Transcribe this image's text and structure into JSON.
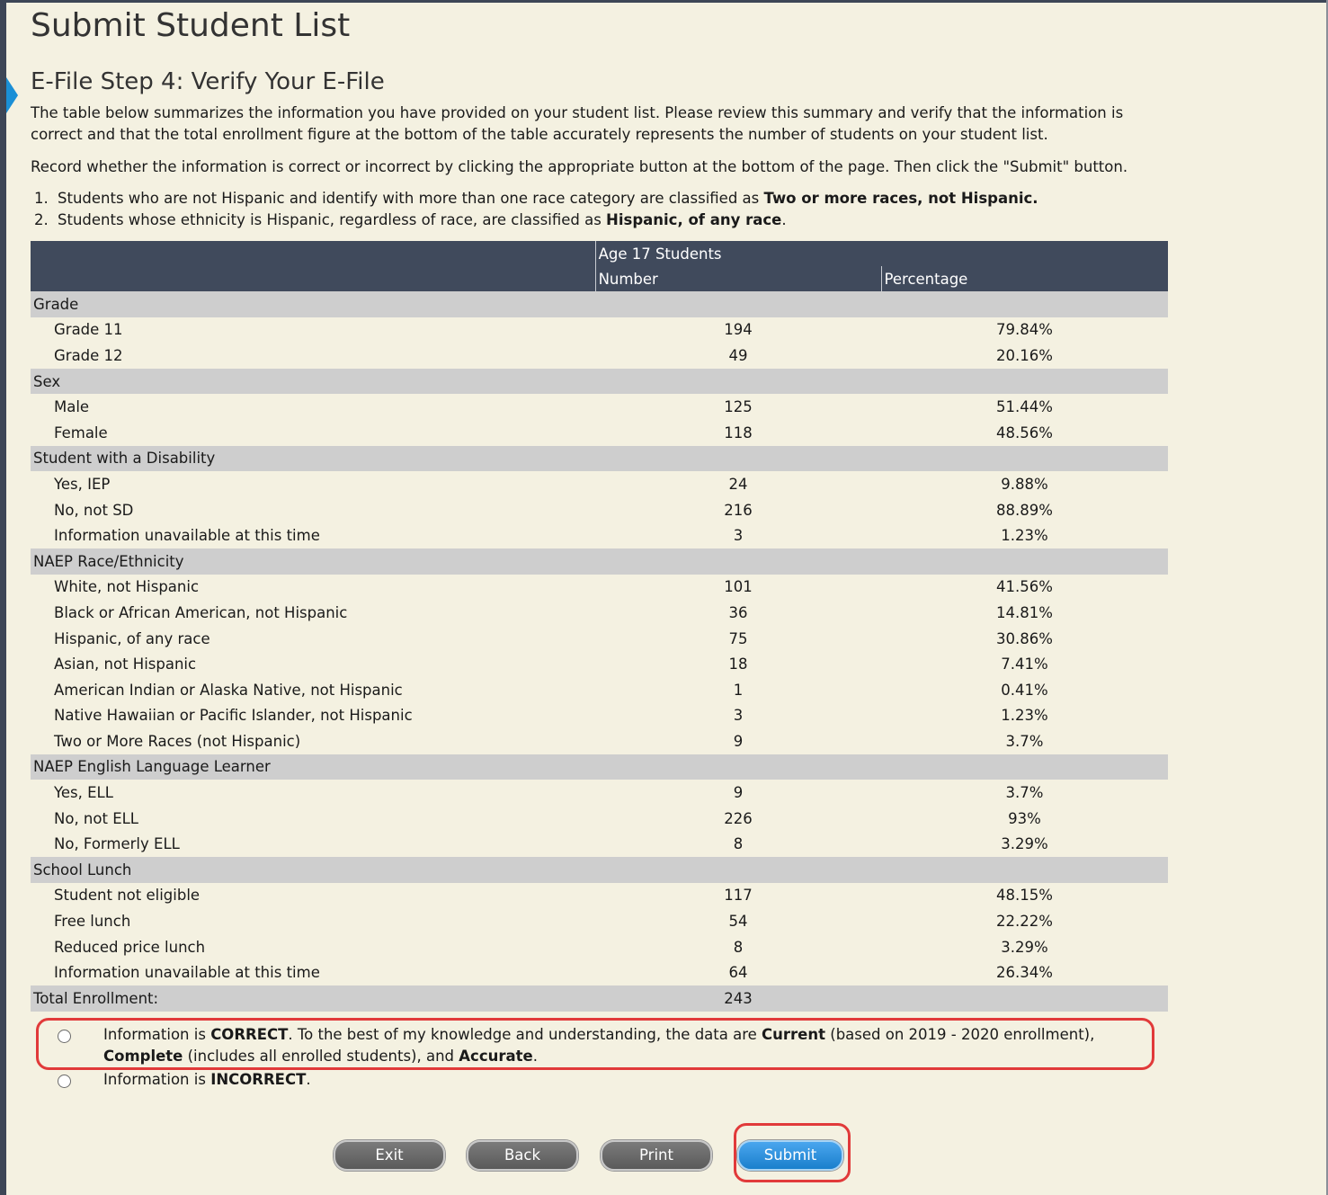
{
  "page": {
    "title": "Submit Student List",
    "step_title": "E-File Step 4: Verify Your E-File",
    "intro": "The table below summarizes the information you have provided on your student list. Please review this summary and verify that the information is correct and that the total enrollment figure at the bottom of the table accurately represents the number of students on your student list.",
    "instruction": "Record whether the information is correct or incorrect by clicking the appropriate button at the bottom of the page. Then click the \"Submit\" button.",
    "notes": [
      {
        "num": "1.",
        "text": "Students who are not Hispanic and identify with more than one race category are classified as ",
        "bold": "Two or more races, not Hispanic."
      },
      {
        "num": "2.",
        "text": "Students whose ethnicity is Hispanic, regardless of race, are classified as ",
        "bold": "Hispanic, of any race",
        "tail": "."
      }
    ]
  },
  "table": {
    "group_header": "Age 17 Students",
    "col_number": "Number",
    "col_percentage": "Percentage",
    "sections": [
      {
        "label": "Grade",
        "rows": [
          {
            "label": "Grade 11",
            "number": "194",
            "pct": "79.84%"
          },
          {
            "label": "Grade 12",
            "number": "49",
            "pct": "20.16%"
          }
        ]
      },
      {
        "label": "Sex",
        "rows": [
          {
            "label": "Male",
            "number": "125",
            "pct": "51.44%"
          },
          {
            "label": "Female",
            "number": "118",
            "pct": "48.56%"
          }
        ]
      },
      {
        "label": "Student with a Disability",
        "rows": [
          {
            "label": "Yes, IEP",
            "number": "24",
            "pct": "9.88%"
          },
          {
            "label": "No, not SD",
            "number": "216",
            "pct": "88.89%"
          },
          {
            "label": "Information unavailable at this time",
            "number": "3",
            "pct": "1.23%"
          }
        ]
      },
      {
        "label": "NAEP Race/Ethnicity",
        "rows": [
          {
            "label": "White, not Hispanic",
            "number": "101",
            "pct": "41.56%"
          },
          {
            "label": "Black or African American, not Hispanic",
            "number": "36",
            "pct": "14.81%"
          },
          {
            "label": "Hispanic, of any race",
            "number": "75",
            "pct": "30.86%"
          },
          {
            "label": "Asian, not Hispanic",
            "number": "18",
            "pct": "7.41%"
          },
          {
            "label": "American Indian or Alaska Native, not Hispanic",
            "number": "1",
            "pct": "0.41%"
          },
          {
            "label": "Native Hawaiian or Pacific Islander, not Hispanic",
            "number": "3",
            "pct": "1.23%"
          },
          {
            "label": "Two or More Races (not Hispanic)",
            "number": "9",
            "pct": "3.7%"
          }
        ]
      },
      {
        "label": "NAEP English Language Learner",
        "rows": [
          {
            "label": "Yes, ELL",
            "number": "9",
            "pct": "3.7%"
          },
          {
            "label": "No, not ELL",
            "number": "226",
            "pct": "93%"
          },
          {
            "label": "No, Formerly ELL",
            "number": "8",
            "pct": "3.29%"
          }
        ]
      },
      {
        "label": "School Lunch",
        "rows": [
          {
            "label": "Student not eligible",
            "number": "117",
            "pct": "48.15%"
          },
          {
            "label": "Free lunch",
            "number": "54",
            "pct": "22.22%"
          },
          {
            "label": "Reduced price lunch",
            "number": "8",
            "pct": "3.29%"
          },
          {
            "label": "Information unavailable at this time",
            "number": "64",
            "pct": "26.34%"
          }
        ]
      }
    ],
    "total_label": "Total Enrollment:",
    "total_value": "243"
  },
  "verify": {
    "correct_parts": [
      "Information is ",
      "CORRECT",
      ". To the best of my knowledge and understanding, the data are ",
      "Current",
      " (based on 2019 - 2020 enrollment), ",
      "Complete",
      " (includes all enrolled students), and ",
      "Accurate",
      "."
    ],
    "incorrect_parts": [
      "Information is ",
      "INCORRECT",
      "."
    ]
  },
  "buttons": {
    "exit": "Exit",
    "back": "Back",
    "print": "Print",
    "submit": "Submit"
  }
}
